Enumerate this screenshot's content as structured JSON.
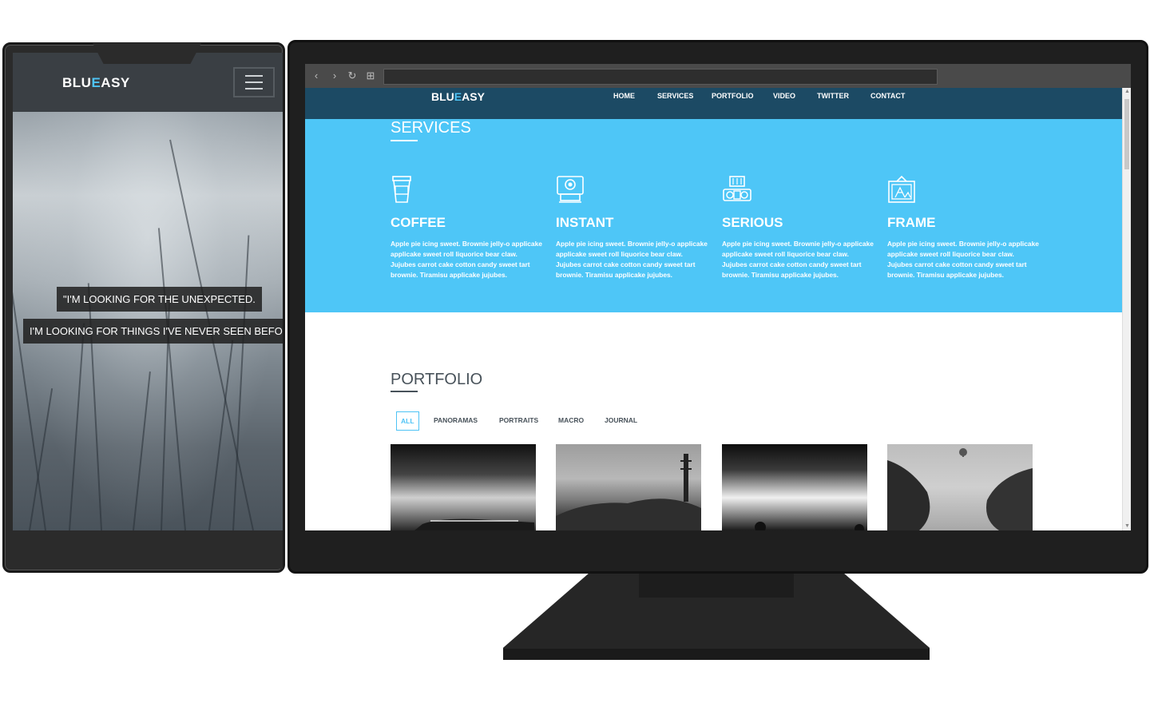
{
  "phone": {
    "logo_main": "BLU",
    "logo_accent": "E",
    "logo_end": "ASY",
    "quote_line1": "\"I'M LOOKING FOR THE UNEXPECTED.",
    "quote_line2": "I'M LOOKING FOR THINGS I'VE NEVER SEEN BEFORE.\""
  },
  "browser": {
    "back_icon": "‹",
    "forward_icon": "›",
    "reload_icon": "↻",
    "apps_icon": "⊞"
  },
  "site": {
    "logo_main": "BLU",
    "logo_accent": "E",
    "logo_end": "ASY",
    "nav": [
      "HOME",
      "SERVICES",
      "PORTFOLIO",
      "VIDEO",
      "TWITTER",
      "CONTACT"
    ],
    "services_title": "SERVICES",
    "services": [
      {
        "title": "COFFEE",
        "icon": "coffee-cup-icon",
        "text": "Apple pie icing sweet. Brownie jelly-o applicake applicake sweet roll liquorice bear claw. Jujubes carrot cake cotton candy sweet tart brownie. Tiramisu applicake jujubes."
      },
      {
        "title": "INSTANT",
        "icon": "instant-camera-icon",
        "text": "Apple pie icing sweet. Brownie jelly-o applicake applicake sweet roll liquorice bear claw. Jujubes carrot cake cotton candy sweet tart brownie. Tiramisu applicake jujubes."
      },
      {
        "title": "SERIOUS",
        "icon": "vintage-camera-icon",
        "text": "Apple pie icing sweet. Brownie jelly-o applicake applicake sweet roll liquorice bear claw. Jujubes carrot cake cotton candy sweet tart brownie. Tiramisu applicake jujubes."
      },
      {
        "title": "FRAME",
        "icon": "picture-frame-icon",
        "text": "Apple pie icing sweet. Brownie jelly-o applicake applicake sweet roll liquorice bear claw. Jujubes carrot cake cotton candy sweet tart brownie. Tiramisu applicake jujubes."
      }
    ],
    "portfolio_title": "PORTFOLIO",
    "filters": [
      "ALL",
      "PANORAMAS",
      "PORTRAITS",
      "MACRO",
      "JOURNAL"
    ],
    "active_filter": "ALL"
  },
  "colors": {
    "accent": "#4ec3f5",
    "nav_bg": "#1c4a64",
    "services_bg": "#4ec6f7",
    "text_dark": "#48525a"
  }
}
